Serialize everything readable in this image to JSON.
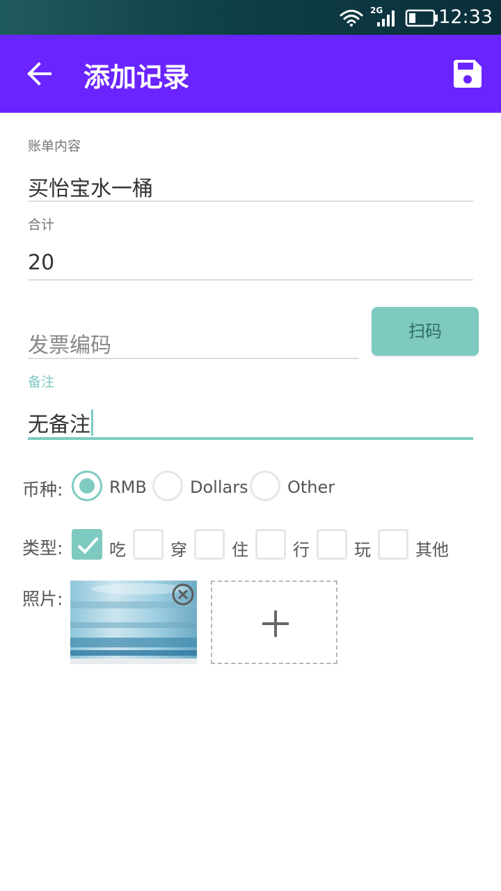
{
  "status_bar": {
    "time": "12:33",
    "network": "2G"
  },
  "app_bar": {
    "title": "添加记录",
    "back_icon": "arrow-left-icon",
    "save_icon": "save-icon"
  },
  "form": {
    "bill": {
      "label": "账单内容",
      "value": "买怡宝水一桶"
    },
    "total": {
      "label": "合计",
      "value": "20"
    },
    "invoice": {
      "placeholder": "发票编码",
      "scan_label": "扫码"
    },
    "note": {
      "label": "备注",
      "value": "无备注"
    }
  },
  "currency": {
    "label": "币种:",
    "options": [
      {
        "text": "RMB",
        "checked": true
      },
      {
        "text": "Dollars",
        "checked": false
      },
      {
        "text": "Other",
        "checked": false
      }
    ]
  },
  "type": {
    "label": "类型:",
    "options": [
      {
        "text": "吃",
        "checked": true
      },
      {
        "text": "穿",
        "checked": false
      },
      {
        "text": "住",
        "checked": false
      },
      {
        "text": "行",
        "checked": false
      },
      {
        "text": "玩",
        "checked": false
      },
      {
        "text": "其他",
        "checked": false
      }
    ]
  },
  "photos": {
    "label": "照片:",
    "remove_icon": "close-circle-icon",
    "add_icon": "plus-icon"
  },
  "colors": {
    "primary": "#6a24ff",
    "accent": "#7ecac1"
  }
}
